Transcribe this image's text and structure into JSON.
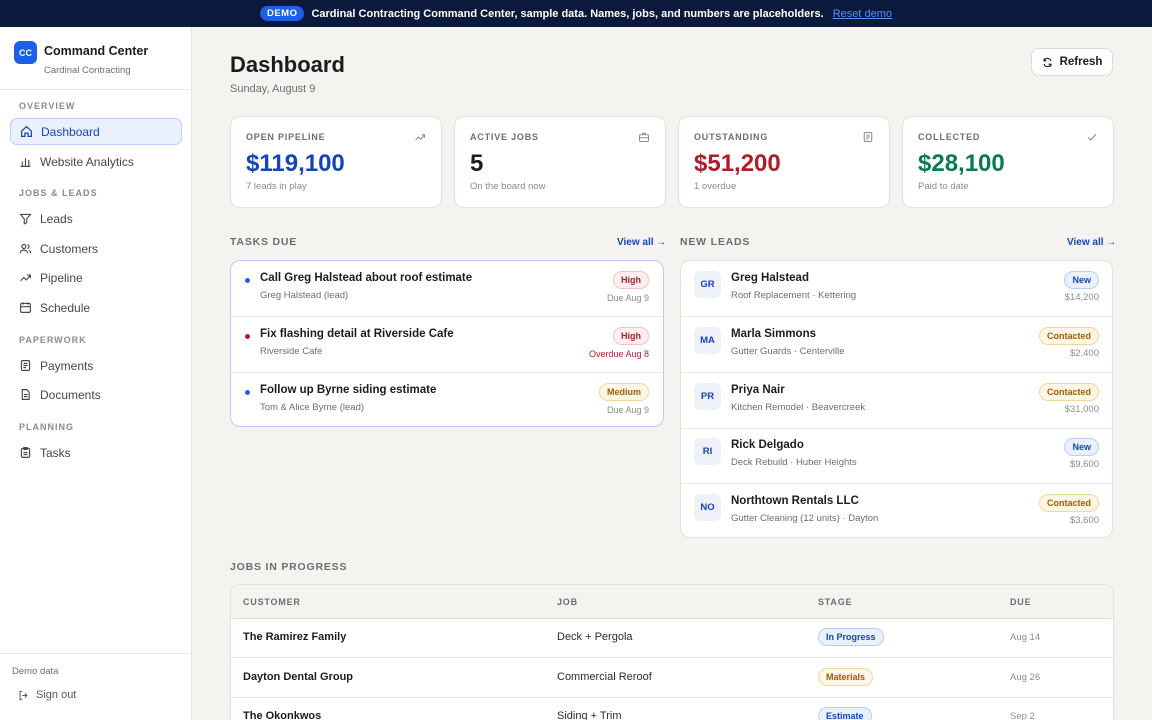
{
  "banner": {
    "badge": "DEMO",
    "message": "Cardinal Contracting Command Center, sample data. Names, jobs, and numbers are placeholders.",
    "reset_link": "Reset demo"
  },
  "brand": {
    "logo": "CC",
    "title": "Command Center",
    "subtitle": "Cardinal Contracting",
    "color": "#1d5fe8"
  },
  "sidebar": {
    "sections": {
      "overview": "OVERVIEW",
      "jobs": "JOBS & LEADS",
      "paperwork": "PAPERWORK",
      "planning": "PLANNING"
    },
    "items": [
      {
        "label": "Dashboard",
        "icon": "home-icon",
        "active": true
      },
      {
        "label": "Website Analytics",
        "icon": "bar-chart-icon"
      },
      {
        "label": "Leads",
        "icon": "filter-icon"
      },
      {
        "label": "Customers",
        "icon": "users-icon"
      },
      {
        "label": "Pipeline",
        "icon": "trend-icon"
      },
      {
        "label": "Schedule",
        "icon": "calendar-icon"
      },
      {
        "label": "Payments",
        "icon": "receipt-icon"
      },
      {
        "label": "Documents",
        "icon": "document-icon"
      },
      {
        "label": "Tasks",
        "icon": "clipboard-icon"
      }
    ],
    "footer_note": "Demo data",
    "sign_out": "Sign out"
  },
  "header": {
    "title": "Dashboard",
    "date": "Sunday, August 9",
    "refresh_label": "Refresh"
  },
  "stats": [
    {
      "label": "OPEN PIPELINE",
      "value": "$119,100",
      "sub": "7 leads in play",
      "color": "#1446b8",
      "icon": "trend-up-icon"
    },
    {
      "label": "ACTIVE JOBS",
      "value": "5",
      "sub": "On the board now",
      "color": "#1b1c20",
      "icon": "briefcase-icon"
    },
    {
      "label": "OUTSTANDING",
      "value": "$51,200",
      "sub": "1 overdue",
      "color": "#b11c2a",
      "icon": "invoice-icon"
    },
    {
      "label": "COLLECTED",
      "value": "$28,100",
      "sub": "Paid to date",
      "color": "#0b7a54",
      "icon": "check-icon"
    }
  ],
  "tasks": {
    "heading": "TASKS DUE",
    "view_all": "View all →",
    "items": [
      {
        "title": "Call Greg Halstead about roof estimate",
        "sub": "Greg Halstead (lead)",
        "priority": "High",
        "due": "Due Aug 9",
        "dot": "#1d5fe8",
        "overdue": false
      },
      {
        "title": "Fix flashing detail at Riverside Cafe",
        "sub": "Riverside Cafe",
        "priority": "High",
        "due": "Overdue Aug 8",
        "dot": "#b11c2a",
        "overdue": true
      },
      {
        "title": "Follow up Byrne siding estimate",
        "sub": "Tom & Alice Byrne (lead)",
        "priority": "Medium",
        "due": "Due Aug 9",
        "dot": "#1d5fe8",
        "overdue": false
      }
    ]
  },
  "leads": {
    "heading": "NEW LEADS",
    "view_all": "View all →",
    "items": [
      {
        "initials": "GR",
        "name": "Greg Halstead",
        "detail": "Roof Replacement · Kettering",
        "status": "New",
        "amount": "$14,200"
      },
      {
        "initials": "MA",
        "name": "Marla Simmons",
        "detail": "Gutter Guards · Centerville",
        "status": "Contacted",
        "amount": "$2,400"
      },
      {
        "initials": "PR",
        "name": "Priya Nair",
        "detail": "Kitchen Remodel · Beavercreek",
        "status": "Contacted",
        "amount": "$31,000"
      },
      {
        "initials": "RI",
        "name": "Rick Delgado",
        "detail": "Deck Rebuild · Huber Heights",
        "status": "New",
        "amount": "$9,600"
      },
      {
        "initials": "NO",
        "name": "Northtown Rentals LLC",
        "detail": "Gutter Cleaning (12 units) · Dayton",
        "status": "Contacted",
        "amount": "$3,600"
      }
    ]
  },
  "jobs": {
    "heading": "JOBS IN PROGRESS",
    "columns": [
      "CUSTOMER",
      "JOB",
      "STAGE",
      "DUE"
    ],
    "rows": [
      {
        "customer": "The Ramirez Family",
        "job": "Deck + Pergola",
        "stage": "In Progress",
        "due": "Aug 14"
      },
      {
        "customer": "Dayton Dental Group",
        "job": "Commercial Reroof",
        "stage": "Materials",
        "due": "Aug 26"
      },
      {
        "customer": "The Okonkwos",
        "job": "Siding + Trim",
        "stage": "Estimate",
        "due": "Sep 2"
      }
    ]
  }
}
